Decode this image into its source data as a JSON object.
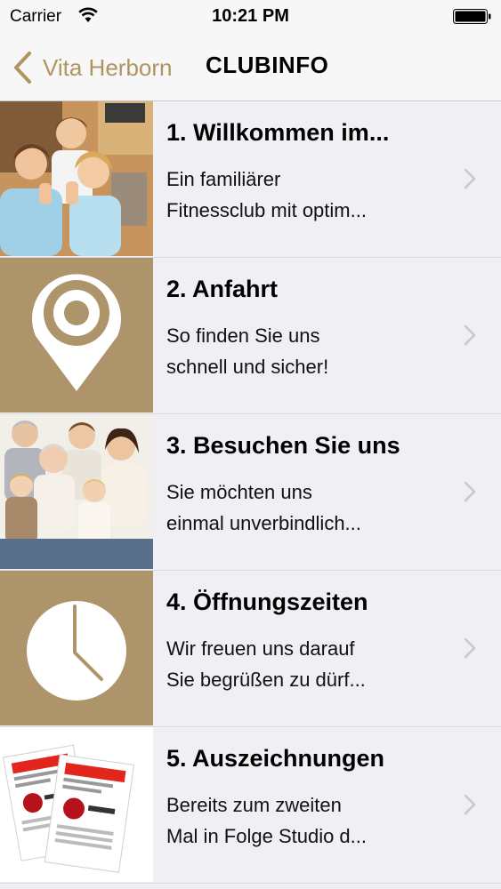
{
  "status_bar": {
    "carrier": "Carrier",
    "time": "10:21 PM"
  },
  "nav": {
    "back_label": "Vita Herborn",
    "title": "CLUBINFO"
  },
  "colors": {
    "accent": "#b09460",
    "thumb_gold": "#ad946a",
    "background": "#efeff4"
  },
  "items": [
    {
      "title": "1. Willkommen im...",
      "subtitle_line1": "Ein familiärer",
      "subtitle_line2": "Fitnessclub mit optim...",
      "thumbnail": "group-photo-thumbs-up"
    },
    {
      "title": "2. Anfahrt",
      "subtitle_line1": "So finden Sie uns",
      "subtitle_line2": "schnell und sicher!",
      "thumbnail": "map-pin-icon"
    },
    {
      "title": "3. Besuchen Sie uns",
      "subtitle_line1": "Sie möchten uns",
      "subtitle_line2": "einmal unverbindlich...",
      "thumbnail": "family-photo"
    },
    {
      "title": "4. Öffnungszeiten",
      "subtitle_line1": "Wir freuen uns darauf",
      "subtitle_line2": "Sie begrüßen zu dürf...",
      "thumbnail": "clock-icon"
    },
    {
      "title": "5. Auszeichnungen",
      "subtitle_line1": "Bereits zum zweiten",
      "subtitle_line2": "Mal in Folge Studio d...",
      "thumbnail": "award-certificates-photo"
    }
  ]
}
